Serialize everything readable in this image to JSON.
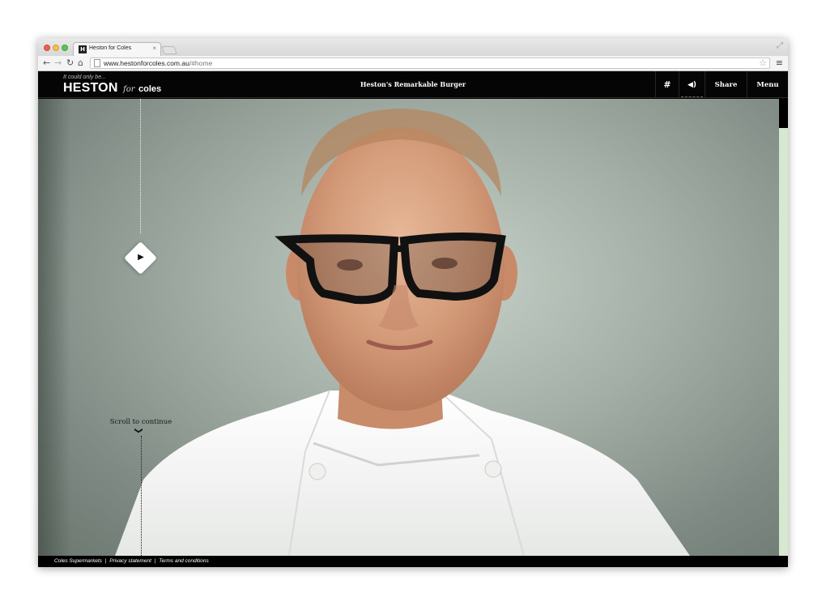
{
  "browser": {
    "tab_title": "Heston for Coles",
    "tab_close": "×",
    "url_host": "www.hestonforcoles.com.au",
    "url_path": "/#home",
    "icons": [
      "back-icon",
      "forward-icon",
      "reload-icon",
      "home-icon",
      "star-icon",
      "menu-icon",
      "resize-icon"
    ]
  },
  "site": {
    "tagline": "It could only be...",
    "logo_main": "HESTON",
    "logo_for": "for",
    "logo_coles": "coles",
    "page_title": "Heston's Remarkable Burger",
    "header_buttons": {
      "hash": "#",
      "sound": "◀)",
      "share": "Share",
      "menu": "Menu"
    },
    "play_icon": "▶",
    "scroll_text": "Scroll to continue",
    "scroll_chevron": "❯",
    "footer": {
      "link1": "Coles Supermarkets",
      "sep1": "|",
      "link2": "Privacy statement",
      "sep2": "|",
      "link3": "Terms and conditions"
    },
    "colors": {
      "header_bg": "#050505",
      "hero_bg": "#a3afa6",
      "right_rail": "#d6e8cf",
      "chef_coat": "#f4f4f2"
    }
  }
}
